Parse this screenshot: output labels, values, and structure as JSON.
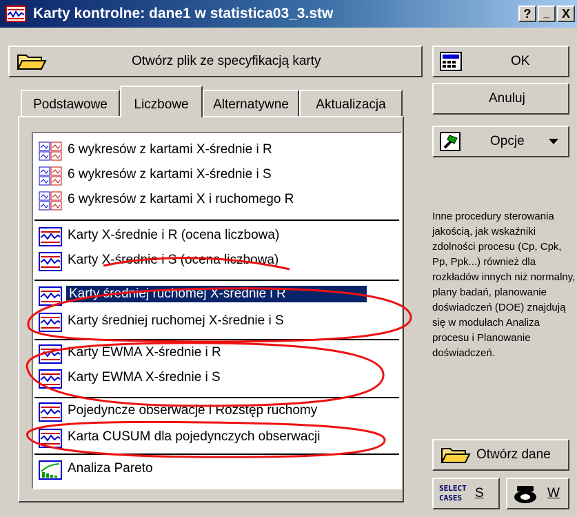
{
  "window": {
    "title": "Karty kontrolne: dane1 w statistica03_3.stw",
    "buttons": [
      "?",
      "_",
      "X"
    ]
  },
  "open_spec_button": "Otwórz plik ze specyfikacją karty",
  "tabs": [
    "Podstawowe",
    "Liczbowe",
    "Alternatywne",
    "Aktualizacja"
  ],
  "active_tab": "Liczbowe",
  "list_items": [
    "6 wykresów z kartami X-średnie i R",
    "6 wykresów z kartami X-średnie i S",
    "6 wykresów z kartami X i ruchomego R",
    "Karty X-średnie i R (ocena liczbowa)",
    "Karty X-średnie i S (ocena liczbowa)",
    "Karty średniej ruchomej X-średnie i R",
    "Karty średniej ruchomej X-średnie i S",
    "Karty EWMA X-średnie i R",
    "Karty EWMA X-średnie i S",
    "Pojedyncze obserwacje i Rozstęp ruchomy",
    "Karta CUSUM dla pojedynczych obserwacji",
    "Analiza Pareto"
  ],
  "selected_item": "Karty średniej ruchomej X-średnie i R",
  "side_buttons": {
    "ok": "OK",
    "cancel": "Anuluj",
    "options": "Opcje",
    "open_data": "Otwórz dane",
    "select_cases": "SELECT CASES",
    "s": "S",
    "w": "W"
  },
  "description": "Inne procedury sterowania jakością, jak wskaźniki zdolności procesu (Cp, Cpk, Pp, Ppk...) również dla rozkładów innych niż normalny, plany badań, planowanie doświadczeń (DOE) znajdują się w modułach Analiza procesu i Planowanie doświadczeń.",
  "colors": {
    "title_start": "#0a246a",
    "title_end": "#a6caf0",
    "face": "#d4d0c8",
    "selection": "#0a246a",
    "annotation": "#ee1111"
  }
}
